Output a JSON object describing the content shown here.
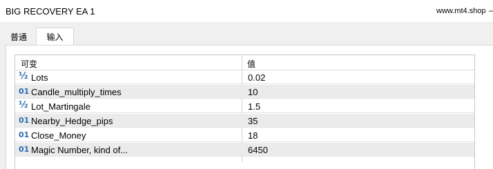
{
  "window": {
    "title": "BIG RECOVERY EA 1",
    "site": "www.mt4.shop",
    "min_glyph": "–"
  },
  "tabs": [
    {
      "label": "普通"
    },
    {
      "label": "输入"
    }
  ],
  "grid": {
    "col_variable": "可变",
    "col_value": "值",
    "rows": [
      {
        "icon": "half-icon",
        "glyph": "½",
        "name": "Lots",
        "value": "0.02"
      },
      {
        "icon": "integer-icon",
        "glyph": "01",
        "name": "Candle_multiply_times",
        "value": "10"
      },
      {
        "icon": "half-icon",
        "glyph": "½",
        "name": "Lot_Martingale",
        "value": "1.5"
      },
      {
        "icon": "integer-icon",
        "glyph": "01",
        "name": "Nearby_Hedge_pips",
        "value": "35"
      },
      {
        "icon": "integer-icon",
        "glyph": "01",
        "name": "Close_Money",
        "value": "18"
      },
      {
        "icon": "integer-icon",
        "glyph": "01",
        "name": "Magic Number, kind of...",
        "value": "6450"
      }
    ]
  }
}
